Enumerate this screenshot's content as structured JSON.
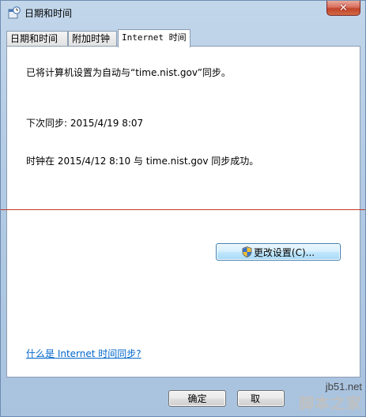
{
  "window": {
    "title": "日期和时间"
  },
  "tabs": [
    {
      "label": "日期和时间",
      "active": false
    },
    {
      "label": "附加时钟",
      "active": false
    },
    {
      "label": "Internet 时间",
      "active": true
    }
  ],
  "panel": {
    "sync_setting": "已将计算机设置为自动与“time.nist.gov”同步。",
    "next_sync": "下次同步: 2015/4/19 8:07",
    "last_sync": "时钟在 2015/4/12 8:10 与 time.nist.gov 同步成功。",
    "change_settings_label": "更改设置(C)...",
    "help_link": "什么是 Internet 时间同步?"
  },
  "buttons": {
    "ok": "确定",
    "cancel": "取"
  },
  "watermark": {
    "url": "jb51.net",
    "name": "脚本之家"
  },
  "colors": {
    "link": "#0066cc",
    "rule": "#c0392b",
    "close": "#c2442b"
  }
}
